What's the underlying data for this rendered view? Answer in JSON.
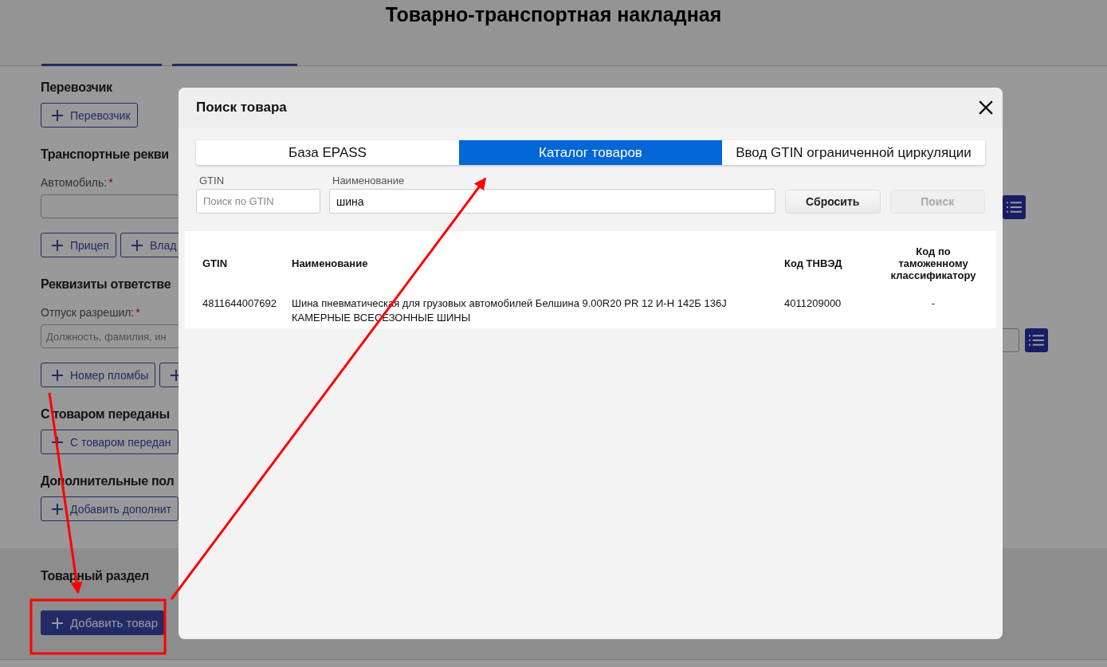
{
  "page": {
    "title": "Товарно-транспортная накладная",
    "sections": [
      {
        "heading": "Перевозчик",
        "buttons": [
          {
            "label": "Перевозчик",
            "clipped": false
          }
        ]
      },
      {
        "heading": "Транспортные рекви",
        "field_label": "Автомобиль:",
        "required_mark": "*",
        "buttons": [
          {
            "label": "Прицеп",
            "clipped": false
          },
          {
            "label": "Влад",
            "clipped": false
          }
        ]
      },
      {
        "heading": "Реквизиты ответстве",
        "field_label": "Отпуск разрешил:",
        "required_mark": "*",
        "field_placeholder": "Должность, фамилия, ин",
        "buttons": [
          {
            "label": "Номер пломбы",
            "clipped": false
          },
          {
            "clipped": true
          }
        ]
      },
      {
        "heading": "С товаром переданы",
        "buttons": [
          {
            "label": "С товаром передан",
            "clipped": false
          }
        ]
      },
      {
        "heading": "Дополнительные пол",
        "buttons": [
          {
            "label": "Добавить дополнит",
            "clipped": false
          }
        ]
      }
    ],
    "goods_section": {
      "heading": "Товарный раздел",
      "add_button": "Добавить товар"
    }
  },
  "dialog": {
    "title": "Поиск товара",
    "tabs": [
      {
        "label": "База EPASS",
        "selected": false
      },
      {
        "label": "Каталог товаров",
        "selected": true
      },
      {
        "label": "Ввод GTIN ограниченной циркуляции",
        "selected": false
      }
    ],
    "gtin_field": {
      "label": "GTIN",
      "placeholder": "Поиск по GTIN"
    },
    "name_field": {
      "label": "Наименование",
      "value": "шина"
    },
    "buttons": [
      {
        "label": "Сбросить",
        "disabled": false
      },
      {
        "label": "Поиск",
        "disabled": true
      }
    ],
    "table": {
      "columns": [
        "GTIN",
        "Наименование",
        "Код ТНВЭД",
        "Код по таможенному классификатору"
      ],
      "rows": [
        [
          "4811644007692",
          "Шина пневматическая для грузовых автомобилей Белшина 9.00R20 PR 12 И-Н 142Б 136J КАМЕРНЫЕ ВСЕСЕЗОННЫЕ ШИНЫ",
          "4011209000",
          "-"
        ]
      ]
    }
  }
}
